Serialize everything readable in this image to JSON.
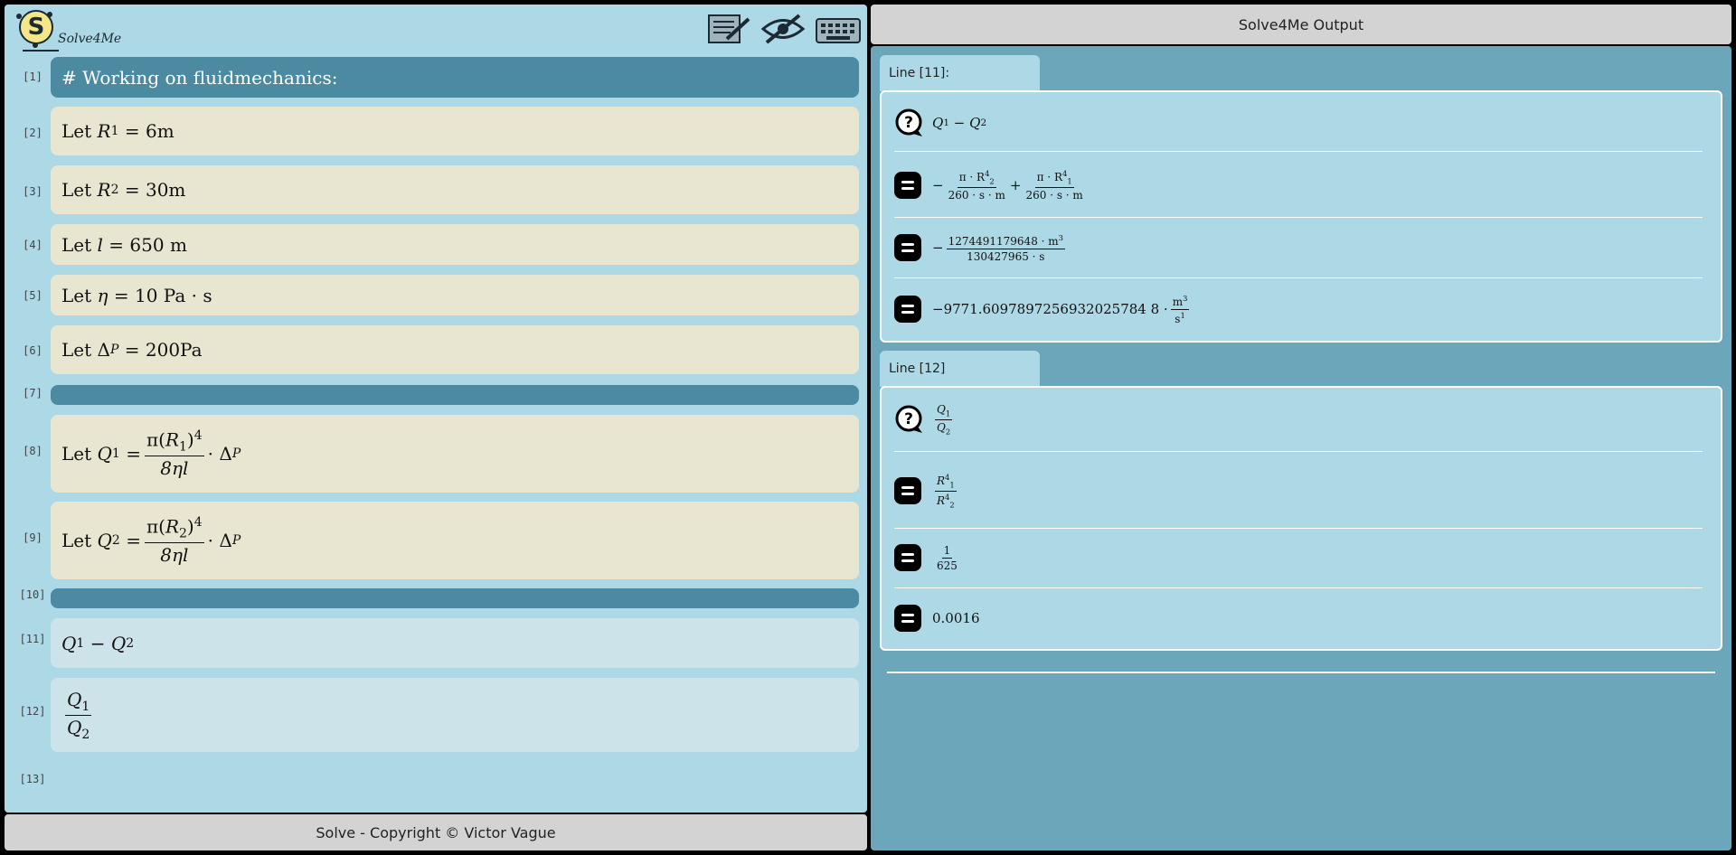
{
  "app": {
    "name": "Solve4Me"
  },
  "toolbar": {
    "icons": [
      "notebook-pen-icon",
      "eye-slash-icon",
      "keyboard-icon"
    ]
  },
  "editor": {
    "line_numbers": [
      "[1]",
      "[2]",
      "[3]",
      "[4]",
      "[5]",
      "[6]",
      "[7]",
      "[8]",
      "[9]",
      "[10]",
      "[11]",
      "[12]",
      "[13]"
    ],
    "line1_text": "# Working on fluidmechanics:",
    "let": "Let",
    "line2": {
      "sym": "R",
      "sub": "1",
      "op": "=",
      "value": "6m"
    },
    "line3": {
      "sym": "R",
      "sub": "2",
      "op": "=",
      "value": "30m"
    },
    "line4": {
      "sym": "l",
      "op": "=",
      "value": "650 m"
    },
    "line5": {
      "sym": "η",
      "op": "=",
      "value": "10 Pa · s"
    },
    "line6": {
      "sym": "Δ",
      "sub": "P",
      "op": "=",
      "value": "200Pa"
    },
    "line8": {
      "sym": "Q",
      "sub": "1",
      "op": "=",
      "pi": "π",
      "inner": "R",
      "inner_sub": "1",
      "pow": "4",
      "den": "8ηl",
      "dot": "·",
      "delta": "Δ",
      "delta_sub": "P"
    },
    "line9": {
      "sym": "Q",
      "sub": "2",
      "op": "=",
      "pi": "π",
      "inner": "R",
      "inner_sub": "2",
      "pow": "4",
      "den": "8ηl",
      "dot": "·",
      "delta": "Δ",
      "delta_sub": "P"
    },
    "line11": {
      "a": "Q",
      "a_sub": "1",
      "op": "−",
      "b": "Q",
      "b_sub": "2"
    },
    "line12": {
      "num": "Q",
      "num_sub": "1",
      "den": "Q",
      "den_sub": "2"
    }
  },
  "footer": {
    "text": "Solve - Copyright © Victor Vague"
  },
  "output": {
    "title": "Solve4Me Output",
    "sections": [
      {
        "tab_label": "Line [11]:",
        "query": {
          "a": "Q",
          "a_sub": "1",
          "op": "−",
          "b": "Q",
          "b_sub": "2"
        },
        "step1": {
          "minus": "−",
          "num1": "π · R",
          "num1_sub": "2",
          "num1_sup": "4",
          "den1": "260 · s · m",
          "plus": "+",
          "num2": "π · R",
          "num2_sub": "1",
          "num2_sup": "4",
          "den2": "260 · s · m"
        },
        "step2": {
          "minus": "−",
          "num": "1274491179648 · m",
          "num_sup": "3",
          "den": "130427965 · s"
        },
        "step3": {
          "value": "−9771.6097897256932025784 8 ·",
          "unit_num": "m",
          "unit_num_sup": "3",
          "unit_den": "s",
          "unit_den_sup": "1"
        }
      },
      {
        "tab_label": "Line [12]",
        "query": {
          "num": "Q",
          "num_sub": "1",
          "den": "Q",
          "den_sub": "2"
        },
        "step1": {
          "num": "R",
          "num_sub": "1",
          "num_sup": "4",
          "den": "R",
          "den_sub": "2",
          "den_sup": "4"
        },
        "step2": {
          "num": "1",
          "den": "625"
        },
        "step3": {
          "value": "0.0016"
        }
      }
    ]
  }
}
